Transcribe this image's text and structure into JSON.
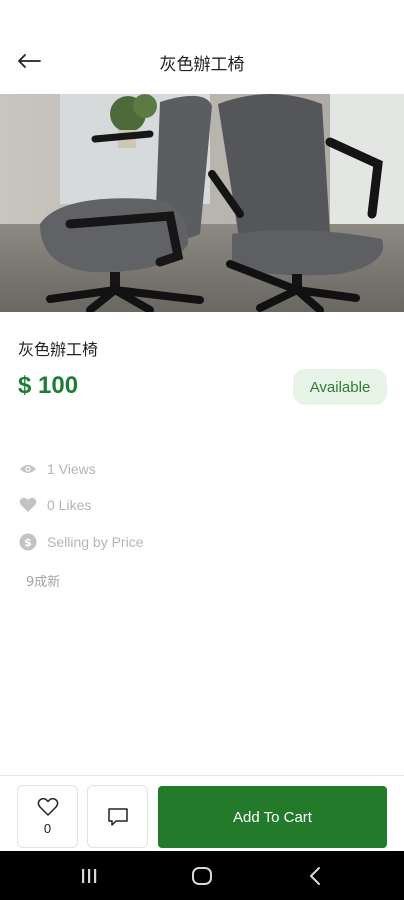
{
  "header": {
    "title": "灰色辦工椅",
    "back_icon": "arrow-left-icon"
  },
  "product": {
    "photo_alt": "灰色辦工椅",
    "name": "灰色辦工椅",
    "price": "$ 100",
    "status": "Available",
    "views": "1 Views",
    "likes": "0 Likes",
    "selling_mode": "Selling by Price",
    "condition": "9成新"
  },
  "actions": {
    "like_count": "0",
    "cart_label": "Add To Cart"
  },
  "colors": {
    "accent": "#237a2a",
    "price": "#1e7e34",
    "badge_bg": "#e8f3e8",
    "meta_text": "#b4b4b4"
  },
  "system_nav": {
    "recents_icon": "recents-icon",
    "home_icon": "home-icon",
    "back_icon": "back-chevron-icon"
  }
}
